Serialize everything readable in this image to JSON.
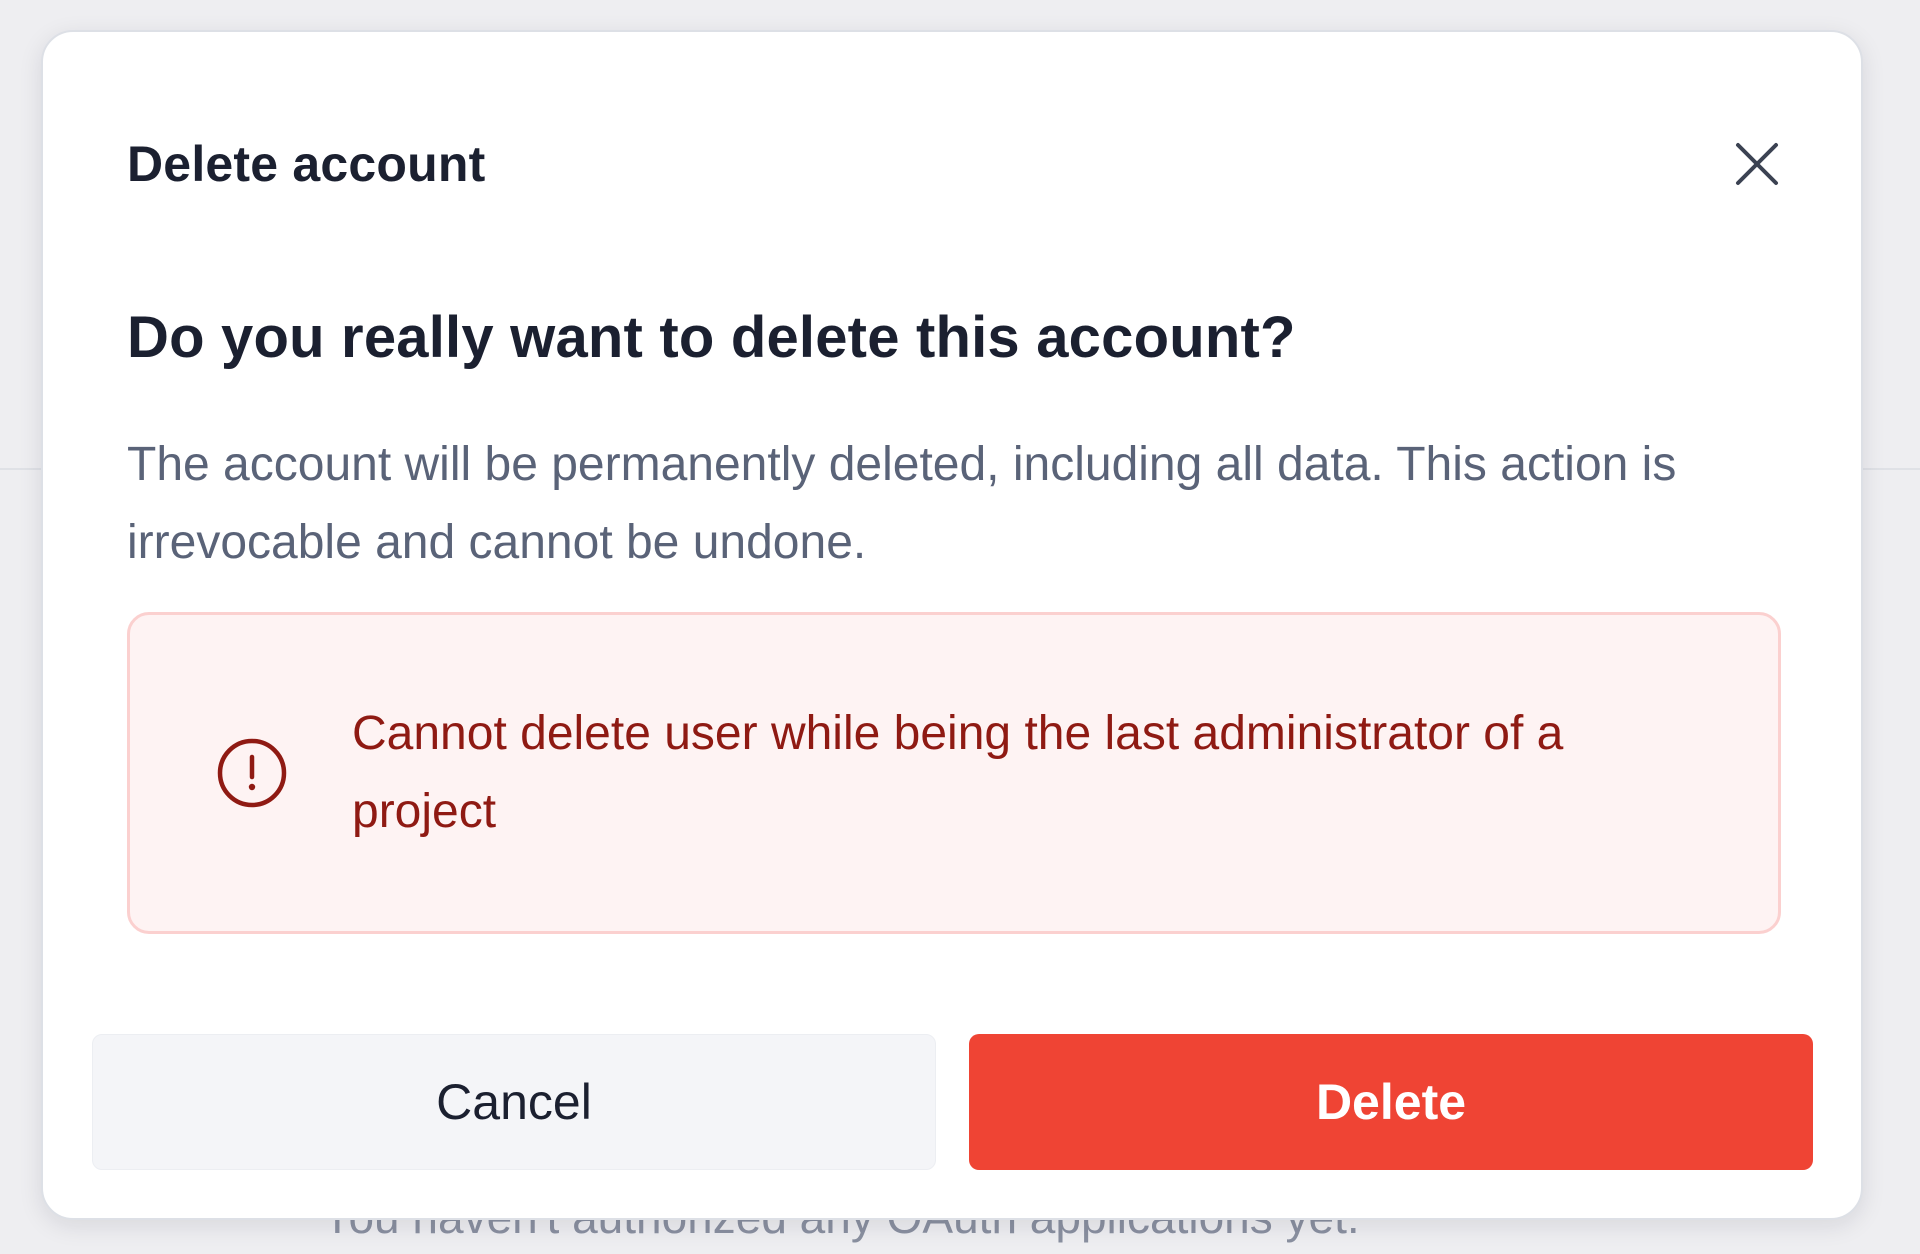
{
  "background": {
    "hint_text": "You haven't authorized any OAuth applications yet."
  },
  "modal": {
    "title": "Delete account",
    "close_icon": "close-icon",
    "question": "Do you really want to delete this account?",
    "description": "The account will be permanently deleted, including all data. This action is irrevocable and cannot be undone.",
    "alert": {
      "icon": "alert-circle-icon",
      "message": "Cannot delete user while being the last administrator of a project"
    },
    "buttons": {
      "cancel_label": "Cancel",
      "delete_label": "Delete"
    }
  },
  "colors": {
    "danger": "#ef4434",
    "alert_bg": "#fef3f3",
    "alert_border": "#fbd0cf",
    "alert_text": "#8f1a13",
    "title_text": "#1b2030",
    "body_text": "#5a6378"
  }
}
